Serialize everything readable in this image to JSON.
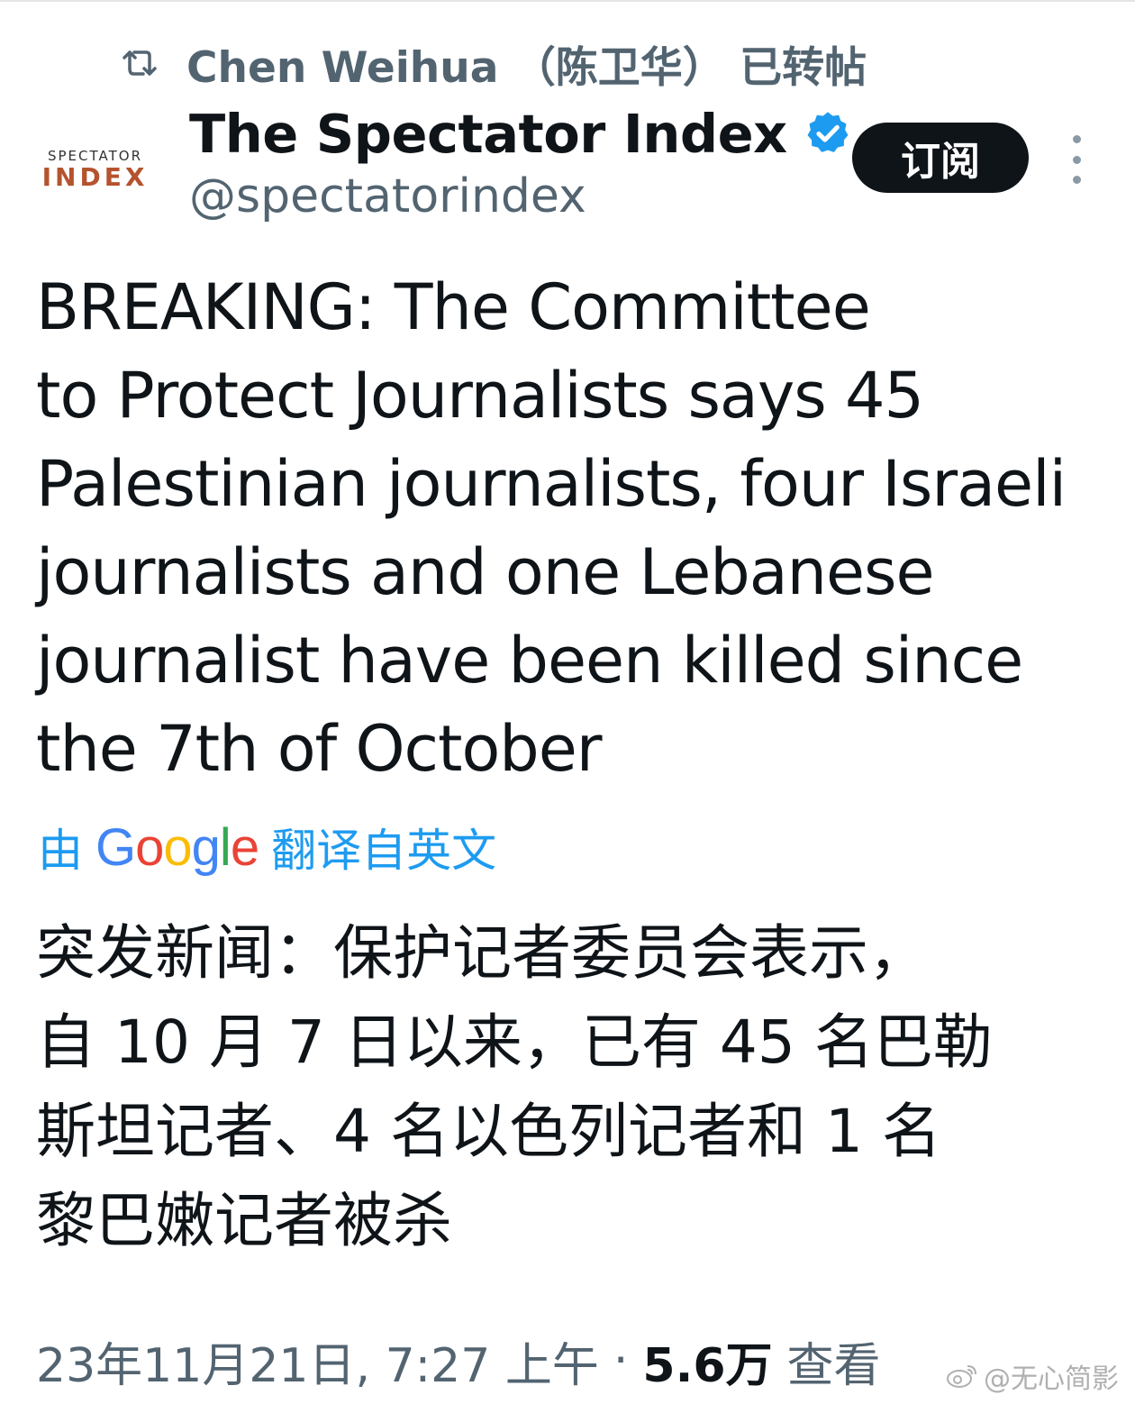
{
  "repost": {
    "text": "Chen Weihua （陈卫华） 已转帖",
    "icon": "repost-icon"
  },
  "author": {
    "avatar_line1": "SPECTATOR",
    "avatar_line2": "INDEX",
    "display_name": "The Spectator Index",
    "handle": "@spectatorindex",
    "verified_icon": "verified-badge-icon",
    "verified_color": "#1d9bf0"
  },
  "actions": {
    "subscribe_label": "订阅",
    "more_icon": "more-vertical-icon"
  },
  "tweet": {
    "text": "BREAKING: The Committee\nto Protect Journalists says 45\nPalestinian journalists, four Israeli\njournalists and one Lebanese\njournalist have been killed since\nthe 7th of October"
  },
  "translation": {
    "prefix": "由",
    "provider": "Google",
    "suffix": "翻译自英文",
    "link_color": "#1d9bf0",
    "text": "突发新闻：保护记者委员会表示，\n自 10 月 7 日以来，已有 45 名巴勒\n斯坦记者、4 名以色列记者和 1 名\n黎巴嫩记者被杀"
  },
  "meta": {
    "timestamp": "23年11月21日, 7:27 上午",
    "separator": "·",
    "views_count": "5.6万",
    "views_label": "查看"
  },
  "watermark": {
    "text": "@无心简影",
    "icon": "weibo-logo-icon"
  }
}
